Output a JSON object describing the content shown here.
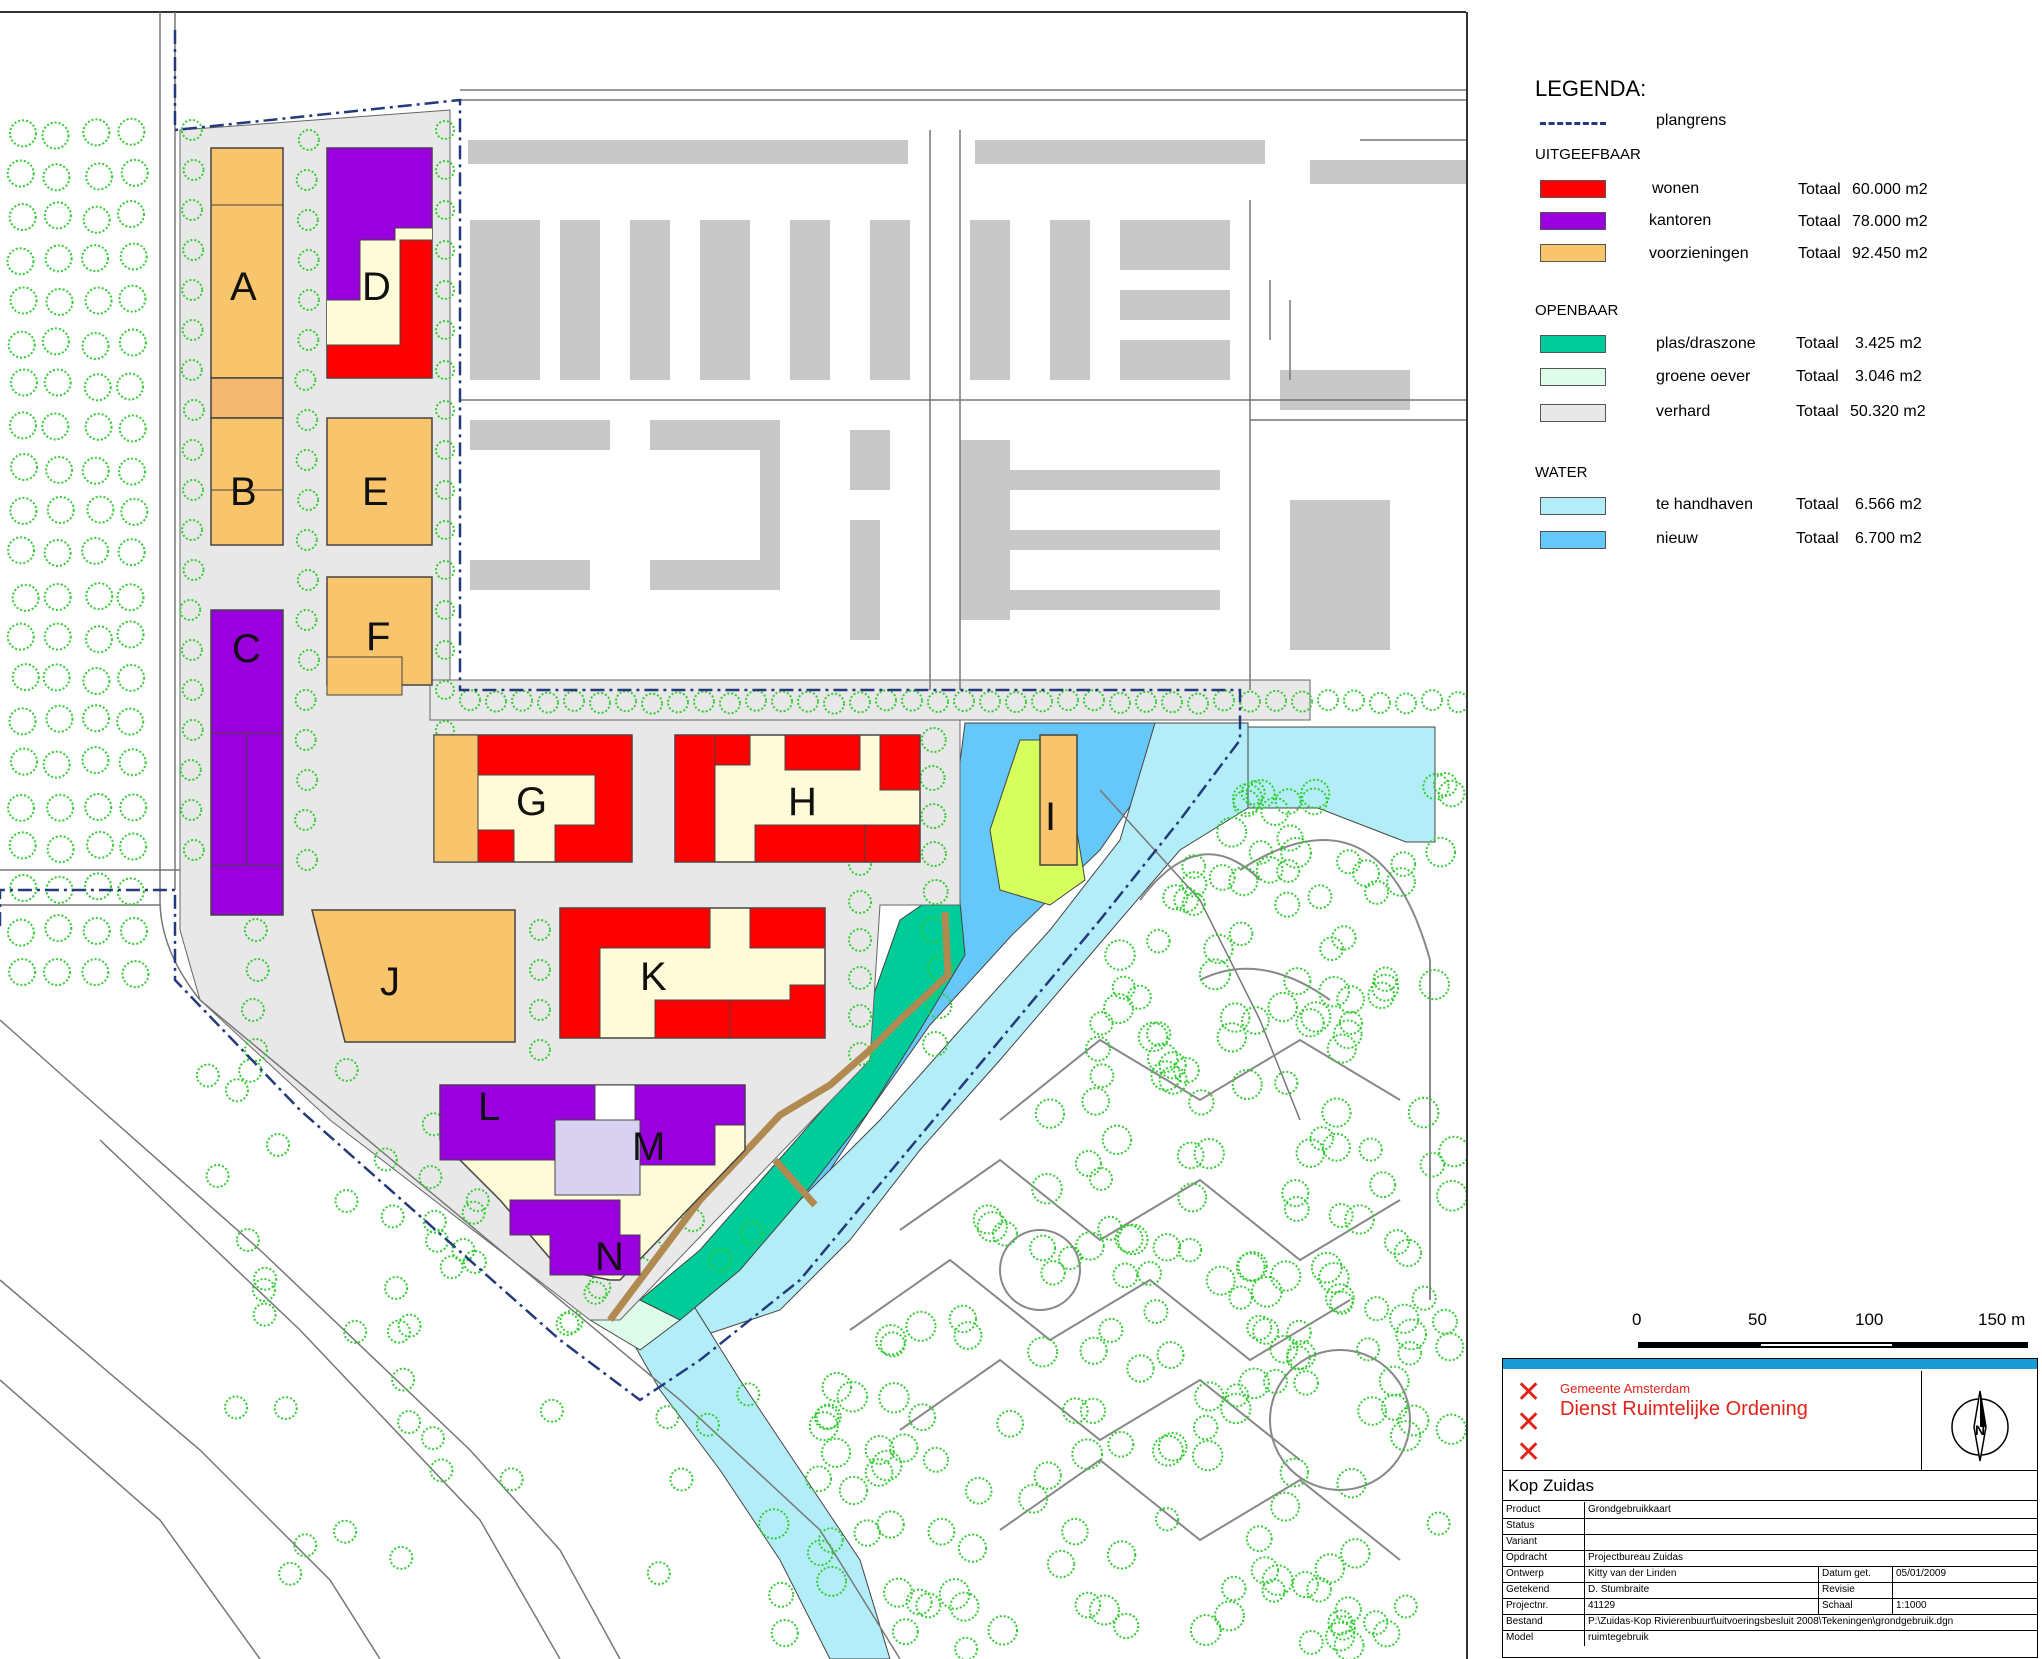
{
  "map": {
    "plots": [
      {
        "label": "A",
        "use": "voorzieningen"
      },
      {
        "label": "B",
        "use": "voorzieningen"
      },
      {
        "label": "C",
        "use": "kantoren"
      },
      {
        "label": "D",
        "use": "kantoren"
      },
      {
        "label": "E",
        "use": "voorzieningen"
      },
      {
        "label": "F",
        "use": "voorzieningen"
      },
      {
        "label": "G",
        "use": "wonen"
      },
      {
        "label": "H",
        "use": "wonen"
      },
      {
        "label": "I",
        "use": "voorzieningen"
      },
      {
        "label": "J",
        "use": "voorzieningen"
      },
      {
        "label": "K",
        "use": "wonen"
      },
      {
        "label": "L",
        "use": "kantoren"
      },
      {
        "label": "M",
        "use": "kantoren"
      },
      {
        "label": "N",
        "use": "kantoren"
      }
    ],
    "colors": {
      "wonen": "#ff0000",
      "kantoren": "#9900dd",
      "voorzieningen": "#f8c46c",
      "plas_draszone": "#00cc99",
      "groene_oever": "#ddfcea",
      "verhard": "#e8e8e8",
      "te_handhaven": "#b3eef8",
      "nieuw": "#66c8f8",
      "courtyard": "#fffbd8",
      "building_gray": "#c8c8c8",
      "tree_green": "#33cc33",
      "path_brown": "#b08a50",
      "plangrens": "#243a7a"
    }
  },
  "legend": {
    "title": "LEGENDA:",
    "plangrens": "plangrens",
    "sections": [
      {
        "title": "UITGEEFBAAR",
        "items": [
          {
            "label": "wonen",
            "totaal": "Totaal",
            "area": "60.000 m2",
            "color": "#ff0000"
          },
          {
            "label": "kantoren",
            "totaal": "Totaal",
            "area": "78.000 m2",
            "color": "#9900dd"
          },
          {
            "label": "voorzieningen",
            "totaal": "Totaal",
            "area": "92.450 m2",
            "color": "#f8c46c"
          }
        ]
      },
      {
        "title": "OPENBAAR",
        "items": [
          {
            "label": "plas/draszone",
            "totaal": "Totaal",
            "area": "3.425 m2",
            "color": "#00cc99"
          },
          {
            "label": "groene oever",
            "totaal": "Totaal",
            "area": "3.046 m2",
            "color": "#ddfcea"
          },
          {
            "label": "verhard",
            "totaal": "Totaal",
            "area": "50.320 m2",
            "color": "#e8e8e8"
          }
        ]
      },
      {
        "title": "WATER",
        "items": [
          {
            "label": "te handhaven",
            "totaal": "Totaal",
            "area": "6.566 m2",
            "color": "#b3eef8"
          },
          {
            "label": "nieuw",
            "totaal": "Totaal",
            "area": "6.700 m2",
            "color": "#66c8f8"
          }
        ]
      }
    ]
  },
  "scale_bar": {
    "ticks": [
      "0",
      "50",
      "100",
      "150 m"
    ]
  },
  "title_block": {
    "org": "Gemeente Amsterdam",
    "dept": "Dienst Ruimtelijke Ordening",
    "project": "Kop Zuidas",
    "compass": "N",
    "rows": [
      {
        "label": "Product",
        "value": "Grondgebruikkaart"
      },
      {
        "label": "Status",
        "value": ""
      },
      {
        "label": "Variant",
        "value": ""
      },
      {
        "label": "Opdracht",
        "value": "Projectbureau Zuidas"
      },
      {
        "label": "Ontwerp",
        "value": "Kitty van der Linden",
        "label2": "Datum get.",
        "value2": "05/01/2009"
      },
      {
        "label": "Getekend",
        "value": "D. Stumbraite",
        "label2": "Revisie",
        "value2": ""
      },
      {
        "label": "Projectnr.",
        "value": "41129",
        "label2": "Schaal",
        "value2": "1:1000"
      },
      {
        "label": "Bestand",
        "value": "P:\\Zuidas-Kop Rivierenbuurt\\uitvoeringsbesluit 2008\\Tekeningen\\grondgebruik.dgn"
      },
      {
        "label": "Model",
        "value": "ruimtegebruik"
      }
    ]
  }
}
